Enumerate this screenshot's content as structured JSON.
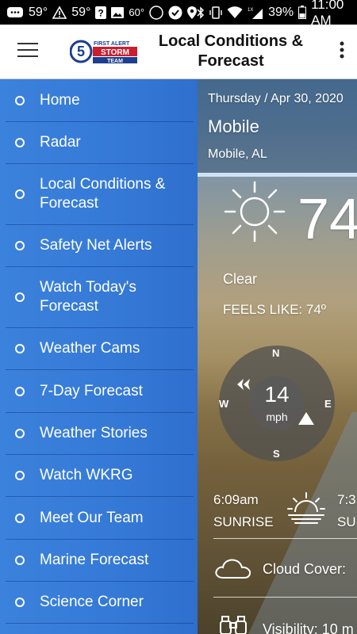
{
  "status_bar": {
    "temp1": "59°",
    "temp2": "59°",
    "temp3": "60°",
    "badge": "39",
    "battery": "39%",
    "time": "11:00 AM",
    "data_label": "1X"
  },
  "app_bar": {
    "title": "Local Conditions & Forecast",
    "logo_text_top": "FIRST ALERT",
    "logo_text_mid": "STORM",
    "logo_text_bot": "TEAM",
    "logo_number": "5"
  },
  "drawer": {
    "items": [
      {
        "label": "Home"
      },
      {
        "label": "Radar"
      },
      {
        "label": "Local Conditions & Forecast"
      },
      {
        "label": "Safety Net Alerts"
      },
      {
        "label": "Watch Today's Forecast"
      },
      {
        "label": "Weather Cams"
      },
      {
        "label": "7-Day Forecast"
      },
      {
        "label": "Weather Stories"
      },
      {
        "label": "Watch WKRG"
      },
      {
        "label": "Meet Our Team"
      },
      {
        "label": "Marine Forecast"
      },
      {
        "label": "Science Corner"
      }
    ]
  },
  "weather": {
    "date": "Thursday / Apr 30, 2020",
    "city": "Mobile",
    "location": "Mobile, AL",
    "temperature": "74",
    "condition": "Clear",
    "feels_like": "FEELS LIKE: 74º",
    "wind": {
      "speed": "14",
      "unit": "mph",
      "n": "N",
      "s": "S",
      "e": "E",
      "w": "W"
    },
    "sunrise_time": "6:09am",
    "sunrise_label": "SUNRISE",
    "sunset_time": "7:3",
    "sunset_label": "SU",
    "cloud_cover": "Cloud Cover:",
    "visibility": "Visibility: 10 m"
  },
  "colors": {
    "drawer_blue": "#3579d6",
    "app_bar_bg": "#ffffff",
    "status_bar_bg": "#000000"
  }
}
